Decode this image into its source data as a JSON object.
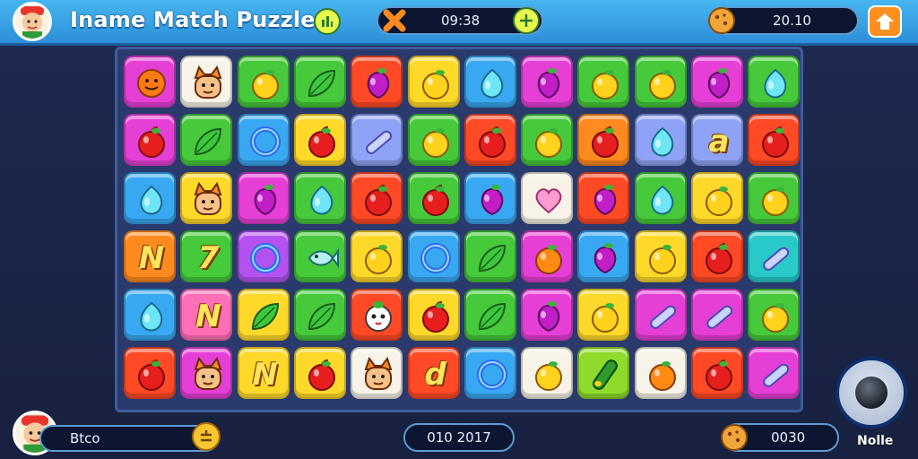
{
  "header": {
    "title": "Iname Match Puzzle",
    "timer": "09:38",
    "score": "20.10"
  },
  "footer": {
    "player_name": "Btco",
    "center_value": "010 2017",
    "coins": "0030",
    "joystick_label": "Nolle"
  },
  "colors": {
    "orange": "#ff8a1f",
    "magenta": "#e63fd6",
    "green": "#46c93a",
    "lime": "#8fdb2b",
    "yellow": "#ffd92a",
    "red": "#ff4a25",
    "blue": "#39a8f2",
    "purple": "#b452f0",
    "pink": "#ff6fb8",
    "teal": "#29c9c9",
    "white": "#f7f3e8",
    "lavender": "#8ea3f5"
  },
  "board": {
    "rows": [
      [
        {
          "bg": "magenta",
          "icon": "face-icon"
        },
        {
          "bg": "white",
          "icon": "cat-icon"
        },
        {
          "bg": "green",
          "icon": "lemon-icon"
        },
        {
          "bg": "green",
          "icon": "leaf-icon"
        },
        {
          "bg": "red",
          "icon": "plum-icon"
        },
        {
          "bg": "yellow",
          "icon": "lemon-icon"
        },
        {
          "bg": "blue",
          "icon": "drop-icon"
        },
        {
          "bg": "magenta",
          "icon": "plum-icon"
        },
        {
          "bg": "green",
          "icon": "lemon-icon"
        },
        {
          "bg": "green",
          "icon": "lemon-icon"
        },
        {
          "bg": "magenta",
          "icon": "plum-icon"
        },
        {
          "bg": "green",
          "icon": "drop-icon"
        }
      ],
      [
        {
          "bg": "magenta",
          "icon": "apple-icon"
        },
        {
          "bg": "green",
          "icon": "leaf-icon"
        },
        {
          "bg": "blue",
          "icon": "ring-icon"
        },
        {
          "bg": "yellow",
          "icon": "apple-icon"
        },
        {
          "bg": "lavender",
          "icon": "bar-icon"
        },
        {
          "bg": "green",
          "icon": "lemon-icon"
        },
        {
          "bg": "red",
          "icon": "apple-icon"
        },
        {
          "bg": "green",
          "icon": "lemon-icon"
        },
        {
          "bg": "orange",
          "icon": "apple-icon"
        },
        {
          "bg": "lavender",
          "icon": "drop-icon"
        },
        {
          "bg": "lavender",
          "icon": "letter-icon",
          "glyph": "a"
        },
        {
          "bg": "red",
          "icon": "apple-icon"
        }
      ],
      [
        {
          "bg": "blue",
          "icon": "drop-icon"
        },
        {
          "bg": "yellow",
          "icon": "cat-icon"
        },
        {
          "bg": "magenta",
          "icon": "plum-icon"
        },
        {
          "bg": "green",
          "icon": "drop-icon"
        },
        {
          "bg": "red",
          "icon": "apple-icon"
        },
        {
          "bg": "green",
          "icon": "apple-icon"
        },
        {
          "bg": "blue",
          "icon": "plum-icon"
        },
        {
          "bg": "white",
          "icon": "heart-icon"
        },
        {
          "bg": "red",
          "icon": "plum-icon"
        },
        {
          "bg": "green",
          "icon": "drop-icon"
        },
        {
          "bg": "yellow",
          "icon": "lemon-icon"
        },
        {
          "bg": "green",
          "icon": "lemon-icon"
        }
      ],
      [
        {
          "bg": "orange",
          "icon": "letter-icon",
          "glyph": "N"
        },
        {
          "bg": "green",
          "icon": "letter-icon",
          "glyph": "7"
        },
        {
          "bg": "purple",
          "icon": "ring-icon"
        },
        {
          "bg": "green",
          "icon": "fish-icon"
        },
        {
          "bg": "yellow",
          "icon": "lemon-icon"
        },
        {
          "bg": "blue",
          "icon": "ring-icon"
        },
        {
          "bg": "green",
          "icon": "leaf-icon"
        },
        {
          "bg": "magenta",
          "icon": "orange-icon"
        },
        {
          "bg": "blue",
          "icon": "plum-icon"
        },
        {
          "bg": "yellow",
          "icon": "lemon-icon"
        },
        {
          "bg": "red",
          "icon": "apple-icon"
        },
        {
          "bg": "teal",
          "icon": "bar-icon"
        }
      ],
      [
        {
          "bg": "blue",
          "icon": "drop-icon"
        },
        {
          "bg": "pink",
          "icon": "letter-icon",
          "glyph": "N"
        },
        {
          "bg": "yellow",
          "icon": "leaf-icon"
        },
        {
          "bg": "green",
          "icon": "leaf-icon"
        },
        {
          "bg": "red",
          "icon": "smile-icon"
        },
        {
          "bg": "yellow",
          "icon": "apple-icon"
        },
        {
          "bg": "green",
          "icon": "leaf-icon"
        },
        {
          "bg": "magenta",
          "icon": "plum-icon"
        },
        {
          "bg": "yellow",
          "icon": "lemon-icon"
        },
        {
          "bg": "magenta",
          "icon": "bar-icon"
        },
        {
          "bg": "magenta",
          "icon": "bar-icon"
        },
        {
          "bg": "green",
          "icon": "lemon-icon"
        }
      ],
      [
        {
          "bg": "red",
          "icon": "apple-icon"
        },
        {
          "bg": "magenta",
          "icon": "cat-icon"
        },
        {
          "bg": "yellow",
          "icon": "letter-icon",
          "glyph": "N"
        },
        {
          "bg": "yellow",
          "icon": "apple-icon"
        },
        {
          "bg": "white",
          "icon": "cat-icon"
        },
        {
          "bg": "red",
          "icon": "letter-icon",
          "glyph": "d"
        },
        {
          "bg": "blue",
          "icon": "ring-icon"
        },
        {
          "bg": "white",
          "icon": "lemon-icon"
        },
        {
          "bg": "lime",
          "icon": "cucumber-icon"
        },
        {
          "bg": "white",
          "icon": "orange-icon"
        },
        {
          "bg": "red",
          "icon": "apple-icon"
        },
        {
          "bg": "magenta",
          "icon": "bar-icon"
        }
      ]
    ]
  }
}
